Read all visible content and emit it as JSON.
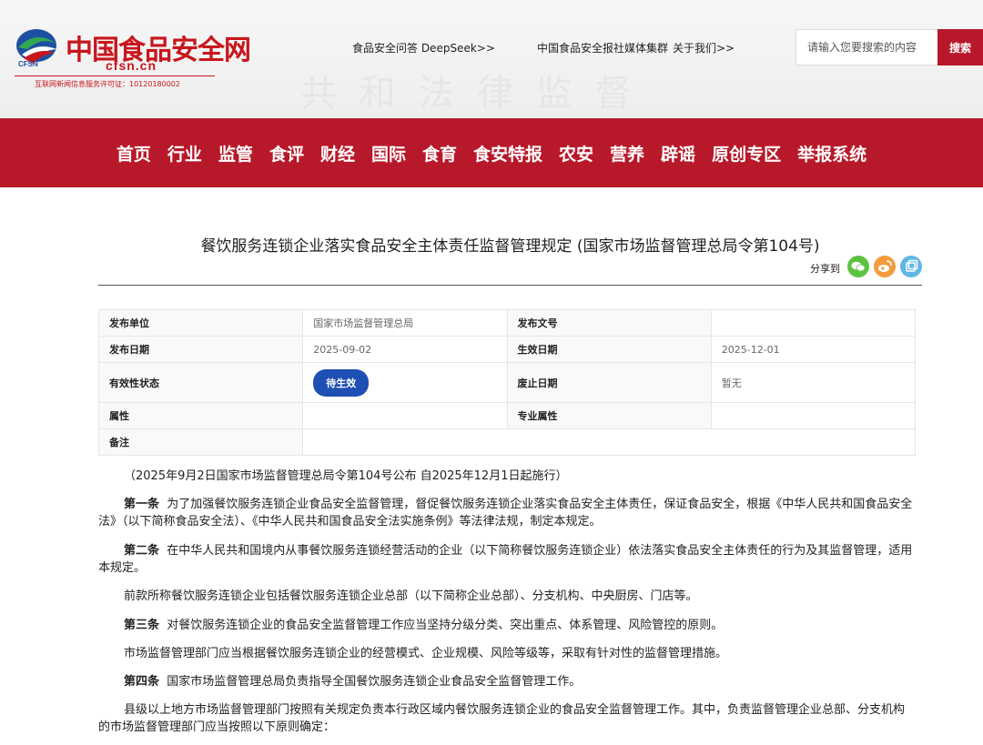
{
  "header": {
    "logo_text": "中国食品安全网",
    "logo_domain": "cfsn.cn",
    "logo_abbrev": "CFSN",
    "license": "互联网新闻信息服务许可证：10120180002",
    "link_deepseek": "食品安全问答 DeepSeek>>",
    "link_media": "中国食品安全报社媒体集群",
    "link_about": "关于我们>>",
    "search_placeholder": "请输入您要搜索的内容",
    "search_button": "搜索"
  },
  "nav": [
    "首页",
    "行业",
    "监管",
    "食评",
    "财经",
    "国际",
    "食育",
    "食安特报",
    "农安",
    "营养",
    "辟谣",
    "原创专区",
    "举报系统"
  ],
  "article": {
    "title": "餐饮服务连锁企业落实食品安全主体责任监督管理规定 (国家市场监督管理总局令第104号)",
    "share_label": "分享到"
  },
  "meta": {
    "publisher_label": "发布单位",
    "publisher": "国家市场监督管理总局",
    "doc_no_label": "发布文号",
    "doc_no": "",
    "pub_date_label": "发布日期",
    "pub_date": "2025-09-02",
    "effective_date_label": "生效日期",
    "effective_date": "2025-12-01",
    "status_label": "有效性状态",
    "status": "待生效",
    "repeal_label": "废止日期",
    "repeal": "暂无",
    "attr_label": "属性",
    "attr": "",
    "spec_attr_label": "专业属性",
    "spec_attr": "",
    "note_label": "备注",
    "note": ""
  },
  "content": {
    "p0": "（2025年9月2日国家市场监督管理总局令第104号公布 自2025年12月1日起施行）",
    "a1_head": "第一条",
    "a1_text": "为了加强餐饮服务连锁企业食品安全监督管理，督促餐饮服务连锁企业落实食品安全主体责任，保证食品安全，根据《中华人民共和国食品安全法》（以下简称食品安全法）、《中华人民共和国食品安全法实施条例》等法律法规，制定本规定。",
    "a2_head": "第二条",
    "a2_text": "在中华人民共和国境内从事餐饮服务连锁经营活动的企业（以下简称餐饮服务连锁企业）依法落实食品安全主体责任的行为及其监督管理，适用本规定。",
    "a2_p2": "前款所称餐饮服务连锁企业包括餐饮服务连锁企业总部（以下简称企业总部）、分支机构、中央厨房、门店等。",
    "a3_head": "第三条",
    "a3_text": "对餐饮服务连锁企业的食品安全监督管理工作应当坚持分级分类、突出重点、体系管理、风险管控的原则。",
    "a3_p2": "市场监督管理部门应当根据餐饮服务连锁企业的经营模式、企业规模、风险等级等，采取有针对性的监督管理措施。",
    "a4_head": "第四条",
    "a4_text": "国家市场监督管理总局负责指导全国餐饮服务连锁企业食品安全监督管理工作。",
    "a4_p2": "县级以上地方市场监督管理部门按照有关规定负责本行政区域内餐饮服务连锁企业的食品安全监督管理工作。其中，负责监督管理企业总部、分支机构的市场监督管理部门应当按照以下原则确定："
  },
  "colors": {
    "brand_red": "#b8192a",
    "status_blue": "#1e4fb5",
    "wechat": "#5cc341",
    "weibo": "#f39c3d",
    "copy": "#5fb7e6"
  }
}
